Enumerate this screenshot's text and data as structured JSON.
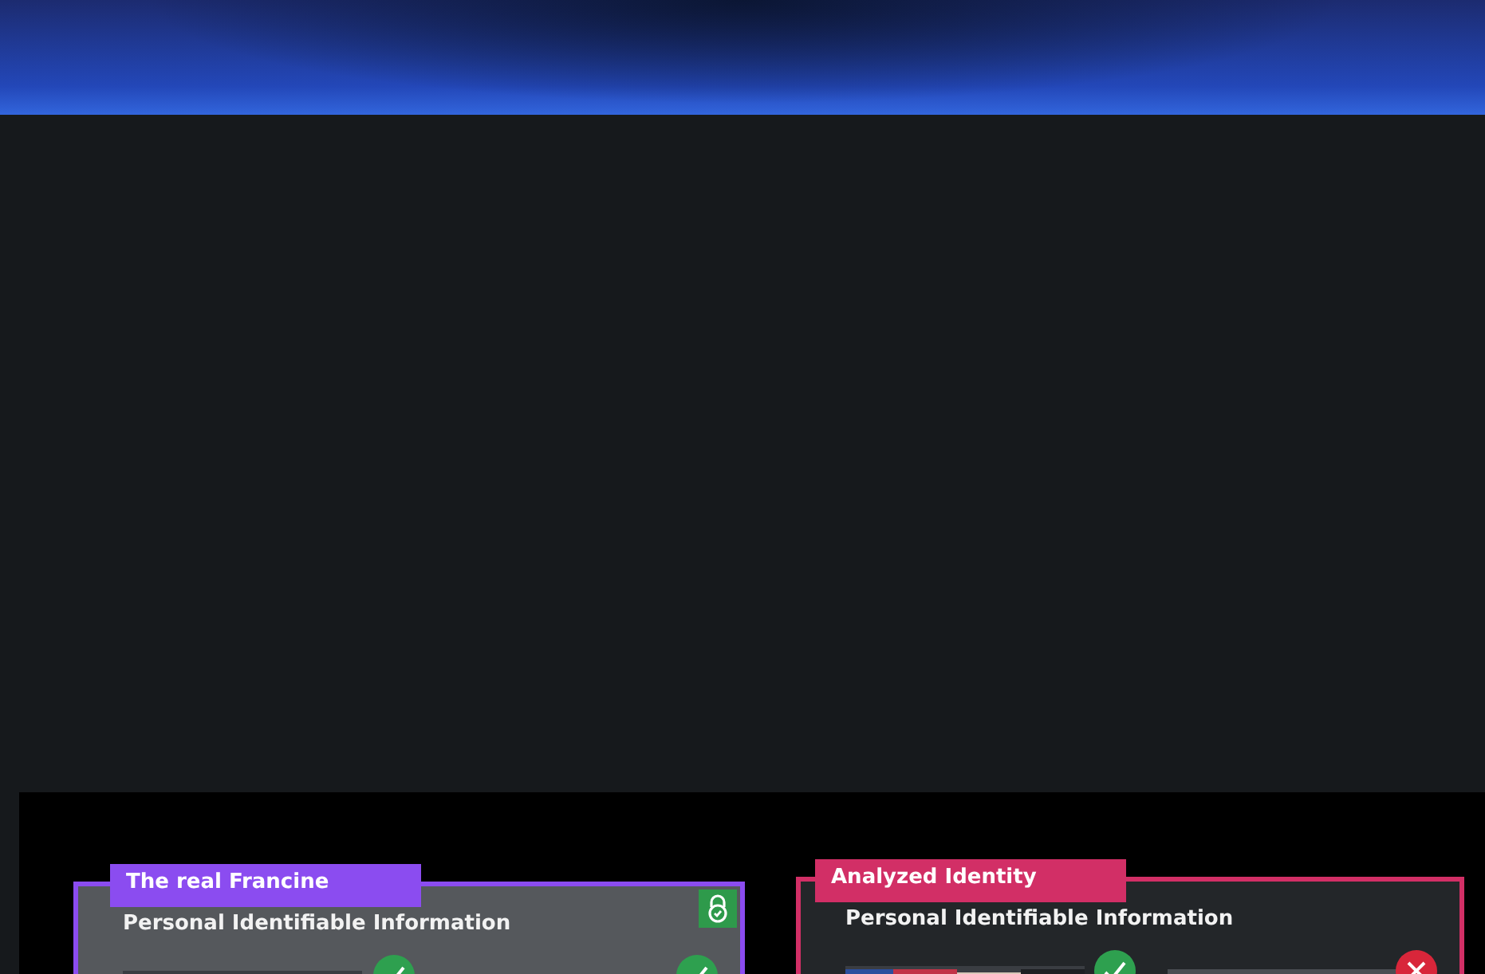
{
  "cards": [
    {
      "title": "The real Francine",
      "kind": "real",
      "locked": true,
      "heading": "Personal Identifiable Information",
      "columns": [
        {
          "kind": "picture",
          "verified": true
        },
        {
          "verified": true
        }
      ]
    },
    {
      "title": "Analyzed Identity",
      "kind": "analyzed",
      "locked": false,
      "heading": "Personal Identifiable Information",
      "columns": [
        {
          "kind": "picture",
          "verified": true
        },
        {
          "kind": "field",
          "verified": false
        }
      ]
    }
  ]
}
